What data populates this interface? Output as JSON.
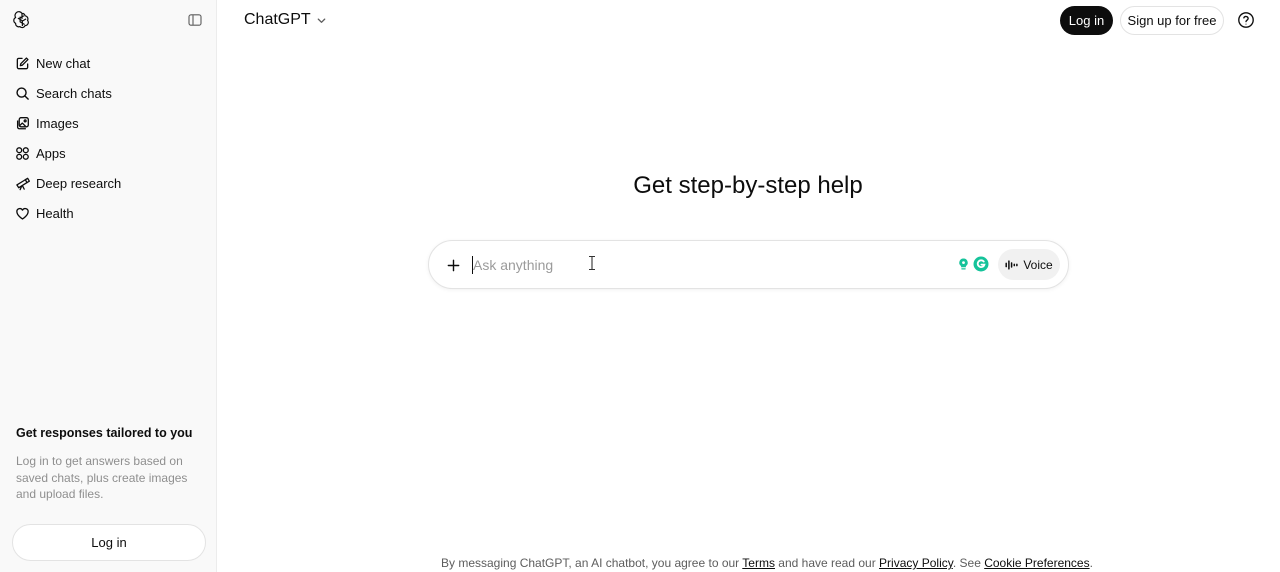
{
  "app": {
    "title": "ChatGPT"
  },
  "sidebar": {
    "items": [
      {
        "label": "New chat",
        "icon": "pencil-square-icon"
      },
      {
        "label": "Search chats",
        "icon": "search-icon"
      },
      {
        "label": "Images",
        "icon": "images-icon"
      },
      {
        "label": "Apps",
        "icon": "apps-grid-icon"
      },
      {
        "label": "Deep research",
        "icon": "telescope-icon"
      },
      {
        "label": "Health",
        "icon": "heart-icon"
      }
    ],
    "promo": {
      "title": "Get responses tailored to you",
      "text": "Log in to get answers based on saved chats, plus create images and upload files."
    },
    "login_label": "Log in"
  },
  "header": {
    "model_label": "ChatGPT",
    "login_label": "Log in",
    "signup_label": "Sign up for free"
  },
  "main": {
    "headline": "Get step-by-step help",
    "composer": {
      "placeholder": "Ask anything",
      "value": "",
      "voice_label": "Voice"
    }
  },
  "footer": {
    "prefix": "By messaging ChatGPT, an AI chatbot, you agree to our ",
    "terms": "Terms",
    "middle": " and have read our ",
    "privacy": "Privacy Policy",
    "see": ". See ",
    "cookies": "Cookie Preferences",
    "suffix": "."
  },
  "colors": {
    "sidebar_bg": "#f9f9f9",
    "primary_button": "#0d0d0d",
    "muted_text": "#8f8f8f",
    "grammarly_green": "#15c39a"
  }
}
